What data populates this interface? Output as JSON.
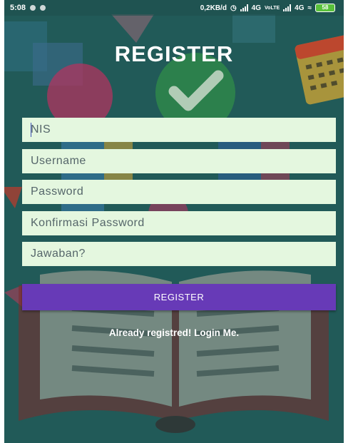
{
  "status_bar": {
    "time": "5:08",
    "network_speed": "0,2KB/d",
    "network_1": "4G",
    "volte": "VoLTE",
    "network_2": "4G",
    "battery": "58"
  },
  "screen": {
    "title": "REGISTER",
    "fields": {
      "nis_placeholder": "NIS",
      "username_placeholder": "Username",
      "password_placeholder": "Password",
      "confirm_password_placeholder": "Konfirmasi Password",
      "answer_placeholder": "Jawaban?"
    },
    "register_button": "REGISTER",
    "login_link": "Already registred! Login Me."
  },
  "colors": {
    "background": "#215a58",
    "field_background": "#e4f7df",
    "button": "#673ab7",
    "text_light": "#ffffff"
  },
  "icons": [
    "clock-icon",
    "signal-icon",
    "wifi-icon",
    "battery-icon",
    "calendar-icon",
    "checkmark-icon",
    "book-icon"
  ]
}
